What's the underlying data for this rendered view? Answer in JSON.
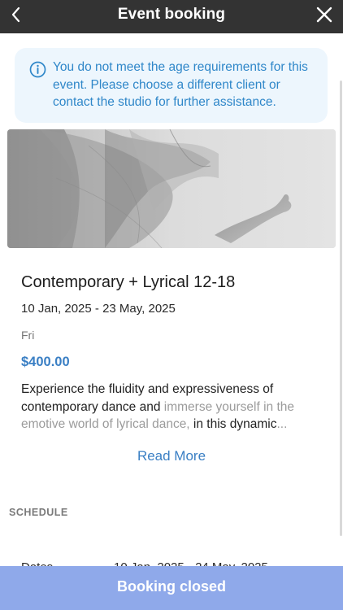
{
  "header": {
    "title": "Event booking",
    "back_icon": "chevron-left-icon",
    "close_icon": "close-icon"
  },
  "alert": {
    "icon": "info-icon",
    "message": "You do not meet the age requirements for this event. Please choose a different client or contact the studio for further assistance.",
    "color": "#2f87c9",
    "background": "#edf6fd"
  },
  "event": {
    "title": "Contemporary + Lyrical 12-18",
    "dates": "10 Jan, 2025 - 23 May, 2025",
    "day": "Fri",
    "price": "$400.00",
    "description_main": "Experience the fluidity and expressiveness of contemporary dance and ",
    "description_fade1": "immerse yourself in the emotive world of lyrical dance,",
    "description_tail": " in this dynamic",
    "description_ellipsis": "...",
    "read_more": "Read More"
  },
  "schedule": {
    "label": "SCHEDULE",
    "row_label": "Dates",
    "row_value": "10 Jan, 2025 - 24 May, 2025"
  },
  "footer": {
    "button": "Booking closed",
    "color": "#8fa9ea"
  },
  "colors": {
    "accent": "#3a7fc4",
    "header_bg": "#333333"
  }
}
